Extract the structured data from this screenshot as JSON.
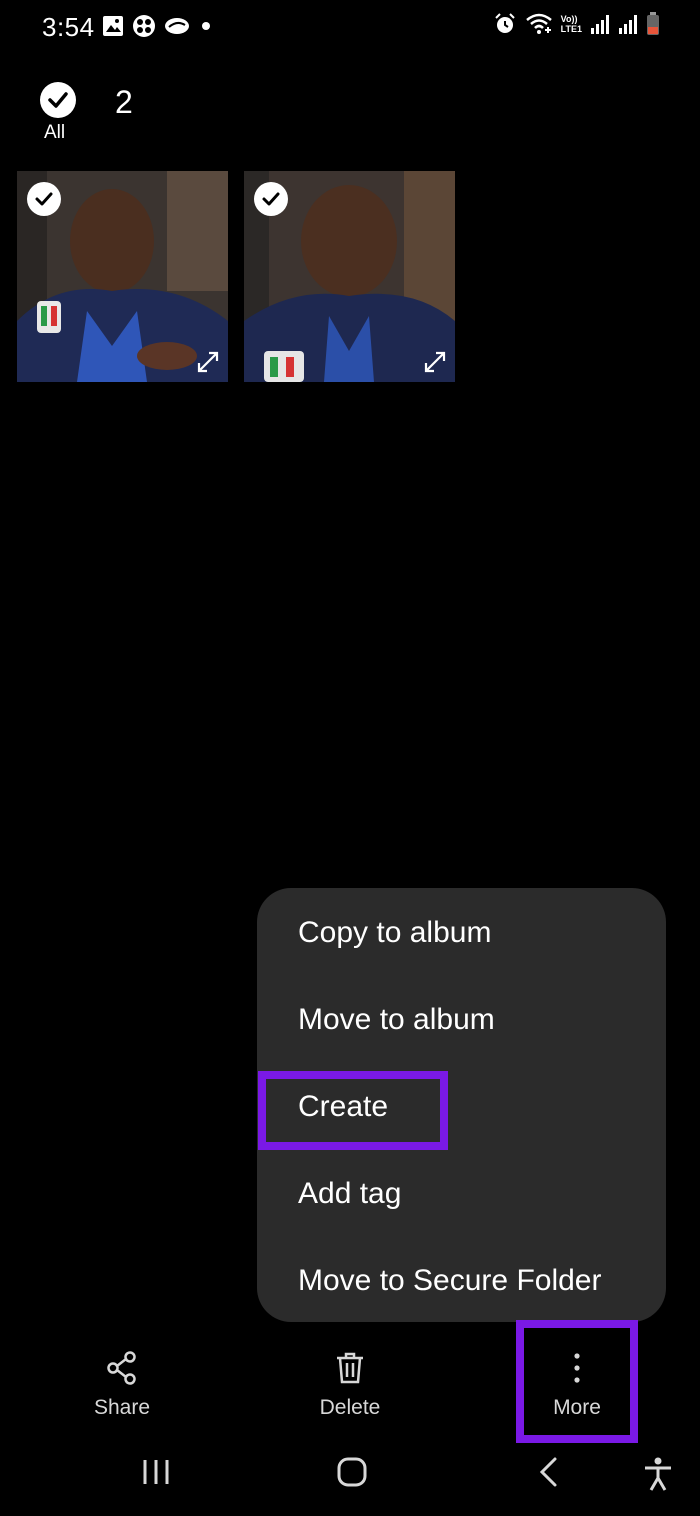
{
  "status_bar": {
    "time": "3:54",
    "left_icons": [
      "gallery-notification-icon",
      "app-notification-icon",
      "cloud-notification-icon",
      "dot-icon"
    ],
    "right_icons": [
      "alarm-icon",
      "wifi-calling-icon",
      "volte-lte-icon",
      "signal-icon",
      "signal-icon",
      "battery-low-icon"
    ],
    "volte_text": "Vo))",
    "lte_text": "LTE1"
  },
  "selection": {
    "select_all_label": "All",
    "count": "2"
  },
  "thumbnails": [
    {
      "type": "video",
      "selected": true
    },
    {
      "type": "video",
      "selected": true
    }
  ],
  "menu": {
    "items": [
      "Copy to album",
      "Move to album",
      "Create",
      "Add tag",
      "Move to Secure Folder"
    ]
  },
  "toolbar": {
    "share_label": "Share",
    "delete_label": "Delete",
    "more_label": "More"
  },
  "nav": {
    "icons": [
      "recent-apps-icon",
      "home-icon",
      "back-icon",
      "accessibility-icon"
    ]
  },
  "colors": {
    "background": "#000000",
    "menu_background": "#2b2b2b",
    "highlight": "#7a19e6"
  }
}
